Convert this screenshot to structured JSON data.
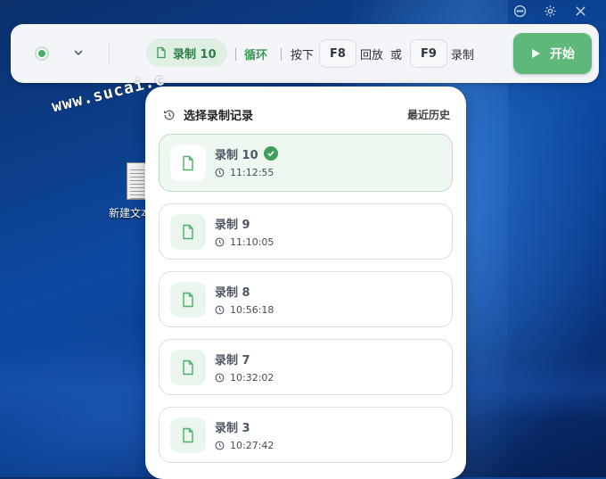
{
  "window_icons": [
    "chat-icon",
    "gear-icon",
    "close-icon"
  ],
  "toolbar": {
    "current_recording": "录制 10",
    "loop_label": "循环",
    "press_label": "按下",
    "playback_key": "F8",
    "playback_label": "回放",
    "or_label": "或",
    "record_key": "F9",
    "record_label": "录制",
    "start_label": "开始"
  },
  "watermark": "www.sucai.c",
  "desktop": {
    "icon_label": "新建文本"
  },
  "panel": {
    "title": "选择录制记录",
    "recent_history": "最近历史",
    "records": [
      {
        "name": "录制 10",
        "time": "11:12:55",
        "selected": true
      },
      {
        "name": "录制 9",
        "time": "11:10:05",
        "selected": false
      },
      {
        "name": "录制 8",
        "time": "10:56:18",
        "selected": false
      },
      {
        "name": "录制 7",
        "time": "10:32:02",
        "selected": false
      },
      {
        "name": "录制 3",
        "time": "10:27:42",
        "selected": false
      }
    ]
  },
  "colors": {
    "accent_green": "#5db87a",
    "text_green": "#2f7d47",
    "selected_bg": "#eef8f1",
    "desktop_blue": "#0c4aa3"
  }
}
